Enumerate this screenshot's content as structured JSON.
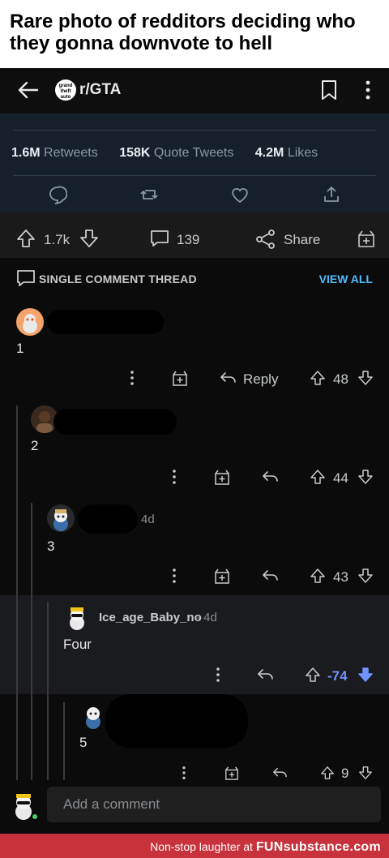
{
  "caption": "Rare photo of redditors deciding who they gonna downvote to hell",
  "appbar": {
    "subreddit_icon_text": "grand theft auto",
    "subreddit": "r/GTA"
  },
  "tweet": {
    "retweets_count": "1.6M",
    "retweets_label": "Retweets",
    "quotes_count": "158K",
    "quotes_label": "Quote Tweets",
    "likes_count": "4.2M",
    "likes_label": "Likes"
  },
  "post_bar": {
    "score": "1.7k",
    "comments": "139",
    "share": "Share"
  },
  "thread_header": {
    "label": "SINGLE COMMENT THREAD",
    "view_all": "VIEW ALL"
  },
  "comments": [
    {
      "text": "1",
      "reply": "Reply",
      "score": "48"
    },
    {
      "text": "2",
      "score": "44"
    },
    {
      "text": "3",
      "age": "4d",
      "score": "43"
    },
    {
      "author": "Ice_age_Baby_no",
      "age": "· 4d",
      "text": "Four",
      "score": "-74"
    },
    {
      "text": "5",
      "score": "9"
    }
  ],
  "composer": {
    "placeholder": "Add a comment"
  },
  "footer": {
    "text": "Non-stop laughter at",
    "brand": "FUNsubstance.com"
  },
  "colors": {
    "downvote_blue": "#7193ff",
    "link_blue": "#4fbcff",
    "footer_red": "#c8323c"
  }
}
